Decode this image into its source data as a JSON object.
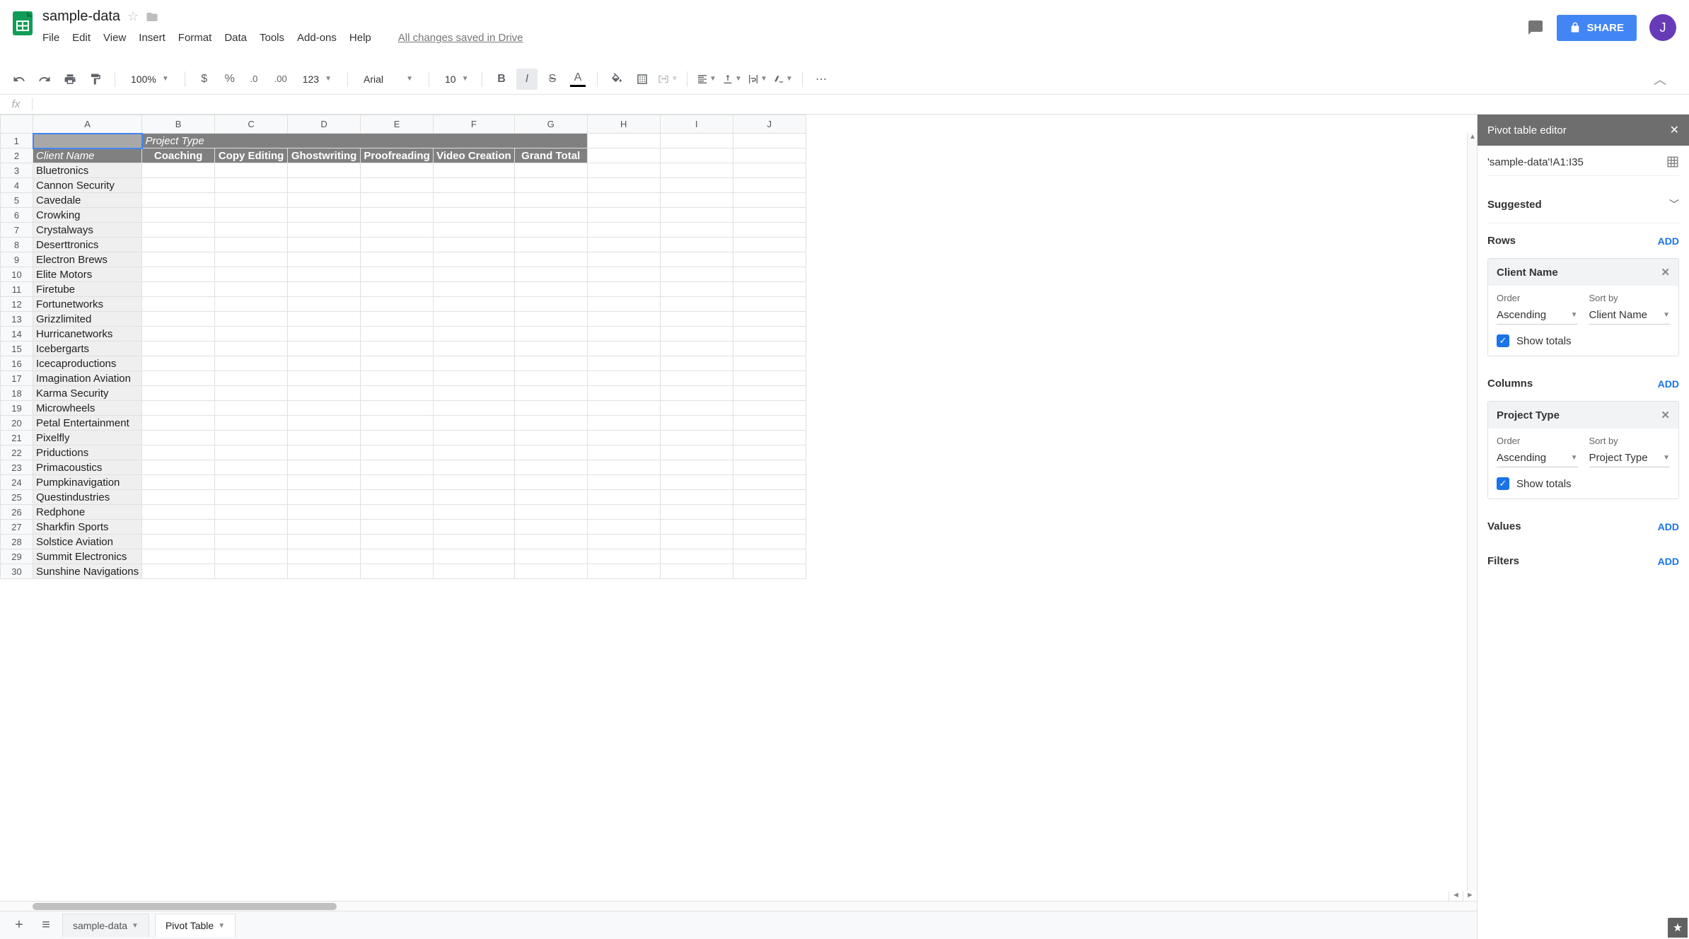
{
  "doc": {
    "title": "sample-data",
    "saved_msg": "All changes saved in Drive"
  },
  "menus": [
    "File",
    "Edit",
    "View",
    "Insert",
    "Format",
    "Data",
    "Tools",
    "Add-ons",
    "Help"
  ],
  "toolbar": {
    "zoom": "100%",
    "font": "Arial",
    "size": "10",
    "numfmt": "123"
  },
  "share": {
    "label": "SHARE"
  },
  "avatar": {
    "initial": "J"
  },
  "columns": [
    "A",
    "B",
    "C",
    "D",
    "E",
    "F",
    "G",
    "H",
    "I",
    "J"
  ],
  "pivot": {
    "corner": "",
    "col_group_label": "Project Type",
    "row_group_label": "Client Name",
    "col_headers": [
      "Coaching",
      "Copy Editing",
      "Ghostwriting",
      "Proofreading",
      "Video Creation",
      "Grand Total"
    ],
    "rows": [
      "Bluetronics",
      "Cannon Security",
      "Cavedale",
      "Crowking",
      "Crystalways",
      "Deserttronics",
      "Electron Brews",
      "Elite Motors",
      "Firetube",
      "Fortunetworks",
      "Grizzlimited",
      "Hurricanetworks",
      "Icebergarts",
      "Icecaproductions",
      "Imagination Aviation",
      "Karma Security",
      "Microwheels",
      "Petal Entertainment",
      "Pixelfly",
      "Priductions",
      "Primacoustics",
      "Pumpkinavigation",
      "Questindustries",
      "Redphone",
      "Sharkfin Sports",
      "Solstice Aviation",
      "Summit Electronics",
      "Sunshine Navigations"
    ]
  },
  "sheettabs": {
    "tab1": "sample-data",
    "tab2": "Pivot Table"
  },
  "sidebar": {
    "title": "Pivot table editor",
    "range": "'sample-data'!A1:I35",
    "suggested": "Suggested",
    "rows_label": "Rows",
    "cols_label": "Columns",
    "values_label": "Values",
    "filters_label": "Filters",
    "add": "ADD",
    "row_field": {
      "name": "Client Name",
      "order_lbl": "Order",
      "order": "Ascending",
      "sort_lbl": "Sort by",
      "sort": "Client Name",
      "show_totals": "Show totals"
    },
    "col_field": {
      "name": "Project Type",
      "order_lbl": "Order",
      "order": "Ascending",
      "sort_lbl": "Sort by",
      "sort": "Project Type",
      "show_totals": "Show totals"
    }
  }
}
